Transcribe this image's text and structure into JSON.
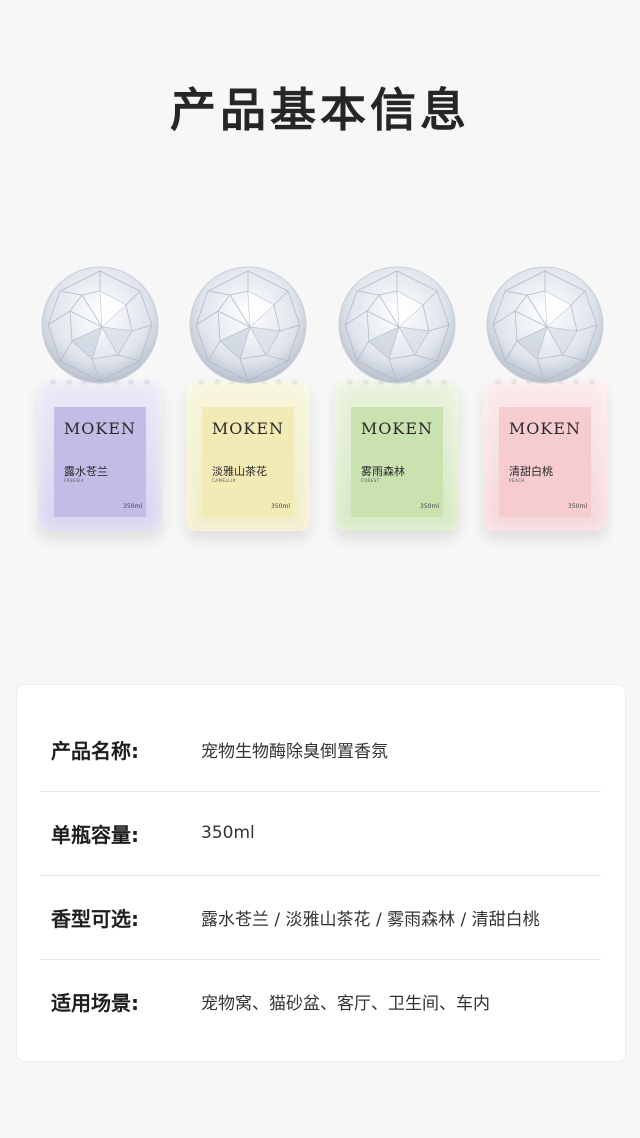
{
  "page_title": "产品基本信息",
  "products": [
    {
      "brand": "MOKEN",
      "name": "露水苍兰",
      "name_en": "FREESIA",
      "volume": "350ml",
      "color": "#cfc6ea",
      "label_color": "#c2b8e6"
    },
    {
      "brand": "MOKEN",
      "name": "淡雅山茶花",
      "name_en": "CAMELLIA",
      "volume": "350ml",
      "color": "#f5f0c9",
      "label_color": "#f1eab3"
    },
    {
      "brand": "MOKEN",
      "name": "雾雨森林",
      "name_en": "FOREST",
      "volume": "350ml",
      "color": "#dcebc9",
      "label_color": "#c8e0ad"
    },
    {
      "brand": "MOKEN",
      "name": "清甜白桃",
      "name_en": "PEACH",
      "volume": "350ml",
      "color": "#f8dde0",
      "label_color": "#f6cdd2"
    }
  ],
  "info": [
    {
      "label": "产品名称:",
      "value": "宠物生物酶除臭倒置香氛"
    },
    {
      "label": "单瓶容量:",
      "value": "350ml"
    },
    {
      "label": "香型可选:",
      "value": "露水苍兰 / 淡雅山茶花 / 雾雨森林 / 清甜白桃"
    },
    {
      "label": "适用场景:",
      "value": "宠物窝、猫砂盆、客厅、卫生间、车内"
    }
  ]
}
